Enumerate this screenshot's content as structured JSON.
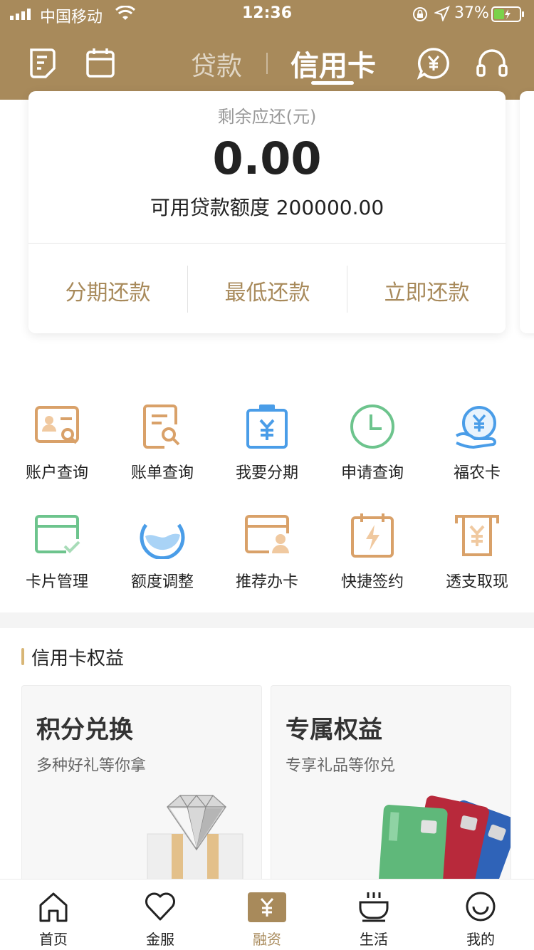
{
  "status_bar": {
    "carrier": "中国移动",
    "time": "12:36",
    "battery_percent": "37%"
  },
  "header": {
    "tabs": [
      {
        "label": "贷款",
        "active": false
      },
      {
        "label": "信用卡",
        "active": true
      }
    ],
    "icons": [
      "document-icon",
      "calendar-icon",
      "yuan-chat-icon",
      "headset-icon"
    ]
  },
  "summary": {
    "label": "剩余应还(元)",
    "amount": "0.00",
    "quota": "可用贷款额度 200000.00",
    "actions": [
      "分期还款",
      "最低还款",
      "立即还款"
    ]
  },
  "services": [
    {
      "label": "账户查询",
      "icon": "account-query-icon"
    },
    {
      "label": "账单查询",
      "icon": "bill-query-icon"
    },
    {
      "label": "我要分期",
      "icon": "installment-icon"
    },
    {
      "label": "申请查询",
      "icon": "clock-icon"
    },
    {
      "label": "福农卡",
      "icon": "yuan-hand-icon"
    },
    {
      "label": "卡片管理",
      "icon": "card-manage-icon"
    },
    {
      "label": "额度调整",
      "icon": "limit-adjust-icon"
    },
    {
      "label": "推荐办卡",
      "icon": "recommend-card-icon"
    },
    {
      "label": "快捷签约",
      "icon": "quick-sign-icon"
    },
    {
      "label": "透支取现",
      "icon": "cash-withdraw-icon"
    }
  ],
  "benefits": {
    "title": "信用卡权益",
    "cards": [
      {
        "title": "积分兑换",
        "subtitle": "多种好礼等你拿"
      },
      {
        "title": "专属权益",
        "subtitle": "专享礼品等你兑"
      }
    ]
  },
  "tabbar": [
    {
      "label": "首页",
      "icon": "home-icon",
      "active": false
    },
    {
      "label": "金服",
      "icon": "heart-icon",
      "active": false
    },
    {
      "label": "融资",
      "icon": "yuan-box-icon",
      "active": true
    },
    {
      "label": "生活",
      "icon": "cup-icon",
      "active": false
    },
    {
      "label": "我的",
      "icon": "smile-icon",
      "active": false
    }
  ],
  "colors": {
    "brand": "#a88a5b",
    "orange": "#d9a169",
    "blue": "#4a9de8",
    "green": "#6dc48d"
  }
}
